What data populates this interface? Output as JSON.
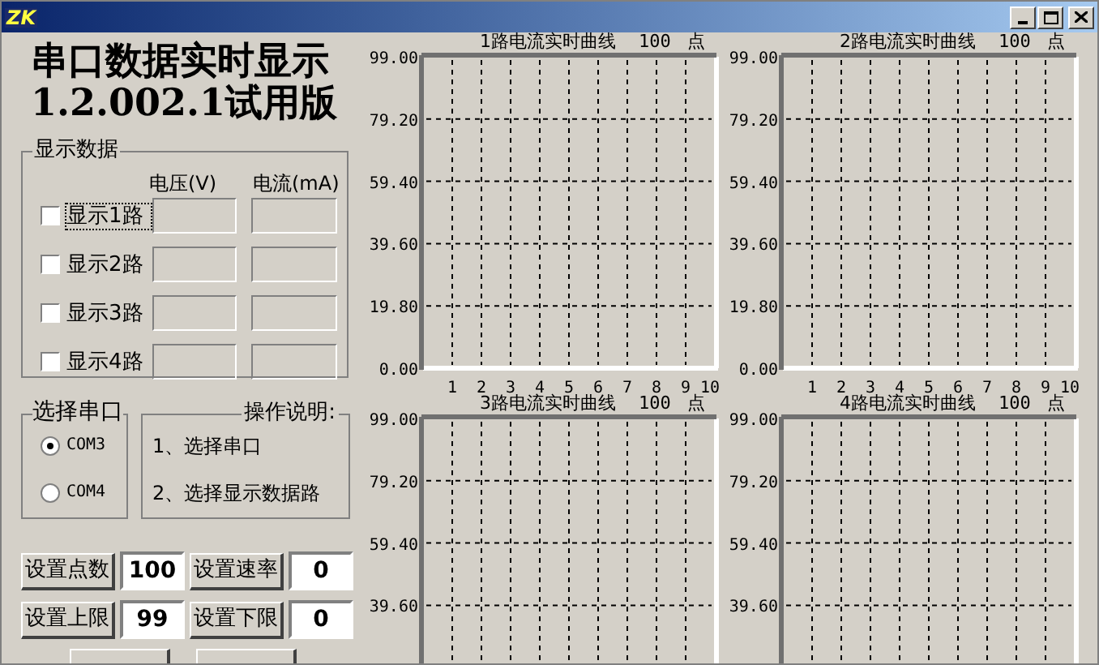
{
  "window": {
    "icon_text": "ZK"
  },
  "app_title": [
    "串口数据实时显示",
    "1.2.002.1试用版"
  ],
  "display_group": {
    "title": "显示数据",
    "columns": [
      "电压(V)",
      "电流(mA)"
    ],
    "channels": [
      {
        "label": "显示1路",
        "checked": false,
        "focused": true
      },
      {
        "label": "显示2路",
        "checked": false,
        "focused": false
      },
      {
        "label": "显示3路",
        "checked": false,
        "focused": false
      },
      {
        "label": "显示4路",
        "checked": false,
        "focused": false
      }
    ]
  },
  "port_group": {
    "title": "选择串口",
    "options": [
      {
        "label": "COM3",
        "selected": true
      },
      {
        "label": "COM4",
        "selected": false
      }
    ]
  },
  "help_group": {
    "title": "操作说明:",
    "lines": [
      "1、选择串口",
      "2、选择显示数据路"
    ]
  },
  "settings": [
    {
      "button": "设置点数",
      "value": "100"
    },
    {
      "button": "设置速率",
      "value": "0"
    },
    {
      "button": "设置上限",
      "value": "99"
    },
    {
      "button": "设置下限",
      "value": "0"
    }
  ],
  "charts": [
    {
      "title": "1路电流实时曲线",
      "points": "100",
      "unit": "点",
      "chart_data": {
        "type": "line",
        "grid": true,
        "xlim": [
          0,
          10
        ],
        "ylim": [
          0,
          99
        ],
        "xticks": [
          1,
          2,
          3,
          4,
          5,
          6,
          7,
          8,
          9,
          10
        ],
        "yticks": [
          {
            "value": 0,
            "label": "0.00"
          },
          {
            "value": 19.8,
            "label": "19.80"
          },
          {
            "value": 39.6,
            "label": "39.60"
          },
          {
            "value": 59.4,
            "label": "59.40"
          },
          {
            "value": 79.2,
            "label": "79.20"
          },
          {
            "value": 99,
            "label": "99.00"
          }
        ]
      }
    },
    {
      "title": "2路电流实时曲线",
      "points": "100",
      "unit": "点",
      "chart_data": {
        "type": "line",
        "grid": true,
        "xlim": [
          0,
          10
        ],
        "ylim": [
          0,
          99
        ],
        "xticks": [
          1,
          2,
          3,
          4,
          5,
          6,
          7,
          8,
          9,
          10
        ],
        "yticks": [
          {
            "value": 0,
            "label": "0.00"
          },
          {
            "value": 19.8,
            "label": "19.80"
          },
          {
            "value": 39.6,
            "label": "39.60"
          },
          {
            "value": 59.4,
            "label": "59.40"
          },
          {
            "value": 79.2,
            "label": "79.20"
          },
          {
            "value": 99,
            "label": "99.00"
          }
        ]
      }
    },
    {
      "title": "3路电流实时曲线",
      "points": "100",
      "unit": "点",
      "chart_data": {
        "type": "line",
        "grid": true,
        "xlim": [
          0,
          10
        ],
        "ylim": [
          0,
          99
        ],
        "yticks": [
          {
            "value": 39.6,
            "label": "39.60"
          },
          {
            "value": 59.4,
            "label": "59.40"
          },
          {
            "value": 79.2,
            "label": "79.20"
          },
          {
            "value": 99,
            "label": "99.00"
          }
        ]
      }
    },
    {
      "title": "4路电流实时曲线",
      "points": "100",
      "unit": "点",
      "chart_data": {
        "type": "line",
        "grid": true,
        "xlim": [
          0,
          10
        ],
        "ylim": [
          0,
          99
        ],
        "yticks": [
          {
            "value": 39.6,
            "label": "39.60"
          },
          {
            "value": 59.4,
            "label": "59.40"
          },
          {
            "value": 79.2,
            "label": "79.20"
          },
          {
            "value": 99,
            "label": "99.00"
          }
        ]
      }
    }
  ]
}
